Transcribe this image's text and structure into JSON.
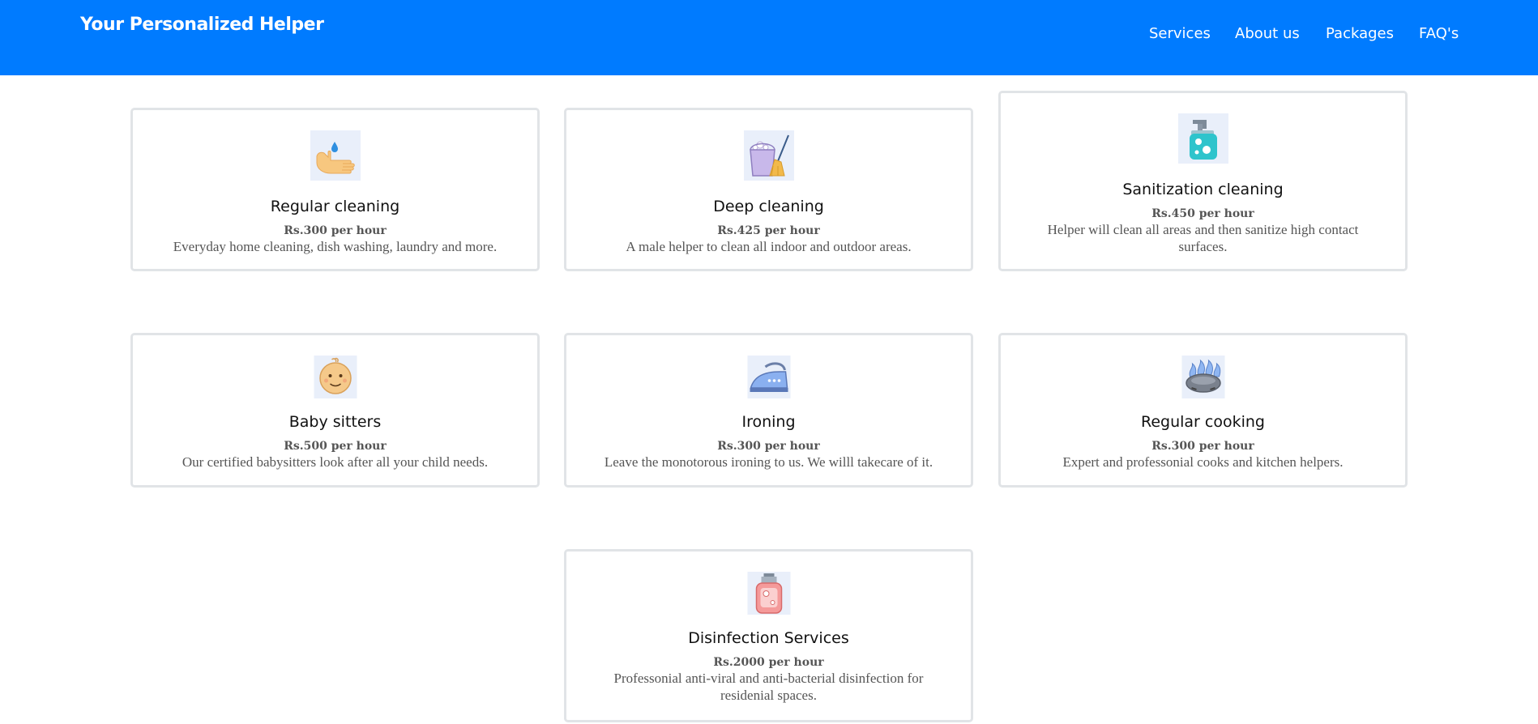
{
  "navbar": {
    "brand": "Your Personalized Helper",
    "links": [
      "Services",
      "About us",
      "Packages",
      "FAQ's"
    ],
    "background_color": "#007bff"
  },
  "services": [
    {
      "icon": "hand-washing-icon",
      "title": "Regular cleaning",
      "price": "Rs.300 per hour",
      "description": "Everyday home cleaning, dish washing, laundry and more."
    },
    {
      "icon": "bucket-broom-icon",
      "title": "Deep cleaning",
      "price": "Rs.425 per hour",
      "description": "A male helper to clean all indoor and outdoor areas."
    },
    {
      "icon": "soap-dispenser-icon",
      "title": "Sanitization cleaning",
      "price": "Rs.450 per hour",
      "description": "Helper will clean all areas and then sanitize high contact surfaces."
    },
    {
      "icon": "baby-face-icon",
      "title": "Baby sitters",
      "price": "Rs.500 per hour",
      "description": "Our certified babysitters look after all your child needs."
    },
    {
      "icon": "iron-icon",
      "title": "Ironing",
      "price": "Rs.300 per hour",
      "description": "Leave the monotorous ironing to us. We willl takecare of it."
    },
    {
      "icon": "gas-burner-icon",
      "title": "Regular cooking",
      "price": "Rs.300 per hour",
      "description": "Expert and professonial cooks and kitchen helpers."
    },
    {
      "icon": "disinfectant-bottle-icon",
      "title": "Disinfection Services",
      "price": "Rs.2000 per hour",
      "description": "Professonial anti-viral and anti-bacterial disinfection for residenial spaces."
    }
  ]
}
